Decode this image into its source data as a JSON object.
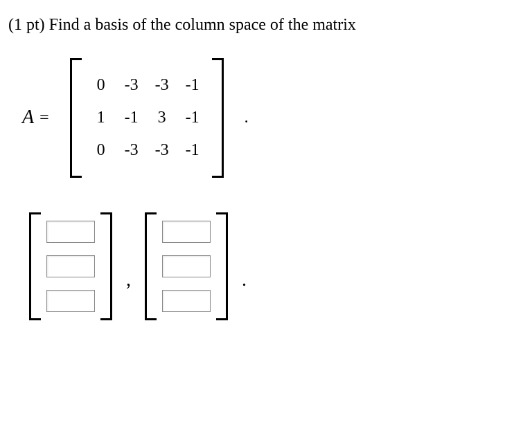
{
  "problem": {
    "points_prefix": "(1 pt) ",
    "text": "Find a basis of the column space of the matrix"
  },
  "matrix": {
    "label": "A",
    "equals": "=",
    "rows": [
      [
        "0",
        "-3",
        "-3",
        "-1"
      ],
      [
        "1",
        "-1",
        "3",
        "-1"
      ],
      [
        "0",
        "-3",
        "-3",
        "-1"
      ]
    ]
  },
  "separator": ",",
  "period": ".",
  "answer": {
    "vector_count": 2,
    "rows_per_vector": 3
  }
}
